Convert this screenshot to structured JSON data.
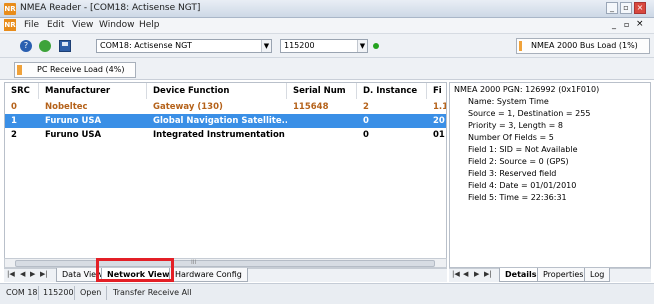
{
  "window": {
    "app_icon_text": "NR",
    "title": "NMEA Reader - [COM18: Actisense NGT]",
    "buttons": {
      "minimize": "_",
      "restore": "▫",
      "close": "×"
    }
  },
  "menu": {
    "icon_text": "NR",
    "items": [
      "File",
      "Edit",
      "View",
      "Window",
      "Help"
    ],
    "mdi_buttons": {
      "minimize": "_",
      "restore": "▫",
      "close": "×"
    }
  },
  "toolbar": {
    "icons": [
      "help-icon",
      "refresh-icon",
      "save-icon"
    ],
    "port_select": {
      "value": "COM18: Actisense NGT"
    },
    "baud_select": {
      "value": "115200"
    },
    "status_indicator_color": "#23a21e",
    "bus_load": {
      "label": "NMEA 2000 Bus Load (1%)",
      "percent": 1
    },
    "pc_load": {
      "label": "PC Receive Load (4%)",
      "percent": 4
    }
  },
  "grid": {
    "columns": [
      "SRC",
      "Manufacturer",
      "Device Function",
      "Serial Num",
      "D. Instance",
      "Fi"
    ],
    "rows": [
      {
        "src": "0",
        "manufacturer": "Nobeltec",
        "function": "Gateway (130)",
        "serial": "115648",
        "instance": "2",
        "fi": "1.1",
        "style": "orange"
      },
      {
        "src": "1",
        "manufacturer": "Furuno USA",
        "function": "Global Navigation Satellite...",
        "serial": "",
        "instance": "0",
        "fi": "20",
        "style": "selected"
      },
      {
        "src": "2",
        "manufacturer": "Furuno USA",
        "function": "Integrated Instrumentation ...",
        "serial": "",
        "instance": "0",
        "fi": "01",
        "style": "normal"
      }
    ],
    "scroll_grip": "III"
  },
  "bottom_tabs": {
    "nav": [
      "|◀",
      "◀",
      "▶",
      "▶|"
    ],
    "items": [
      "Data View",
      "Network View",
      "Hardware Config"
    ],
    "active": "Network View"
  },
  "details": {
    "lines": [
      "NMEA 2000 PGN: 126992 (0x1F010)",
      "Name: System Time",
      "Source = 1, Destination = 255",
      "Priority = 3, Length = 8",
      "Number Of Fields = 5",
      "Field 1: SID = Not Available",
      "Field 2: Source = 0 (GPS)",
      "Field 3: Reserved field",
      "Field 4: Date = 01/01/2010",
      "Field 5: Time = 22:36:31"
    ],
    "tabs": [
      "Details",
      "Properties",
      "Log"
    ],
    "nav": [
      "|◀",
      "◀",
      "▶",
      "▶|"
    ]
  },
  "statusbar": {
    "port": "COM 18",
    "baud": "115200",
    "state": "Open",
    "mode": "Transfer Receive All"
  },
  "colors": {
    "selected_row": "#3a8fe6",
    "orange_text": "#b5621a",
    "highlight_box": "#e31f26"
  }
}
